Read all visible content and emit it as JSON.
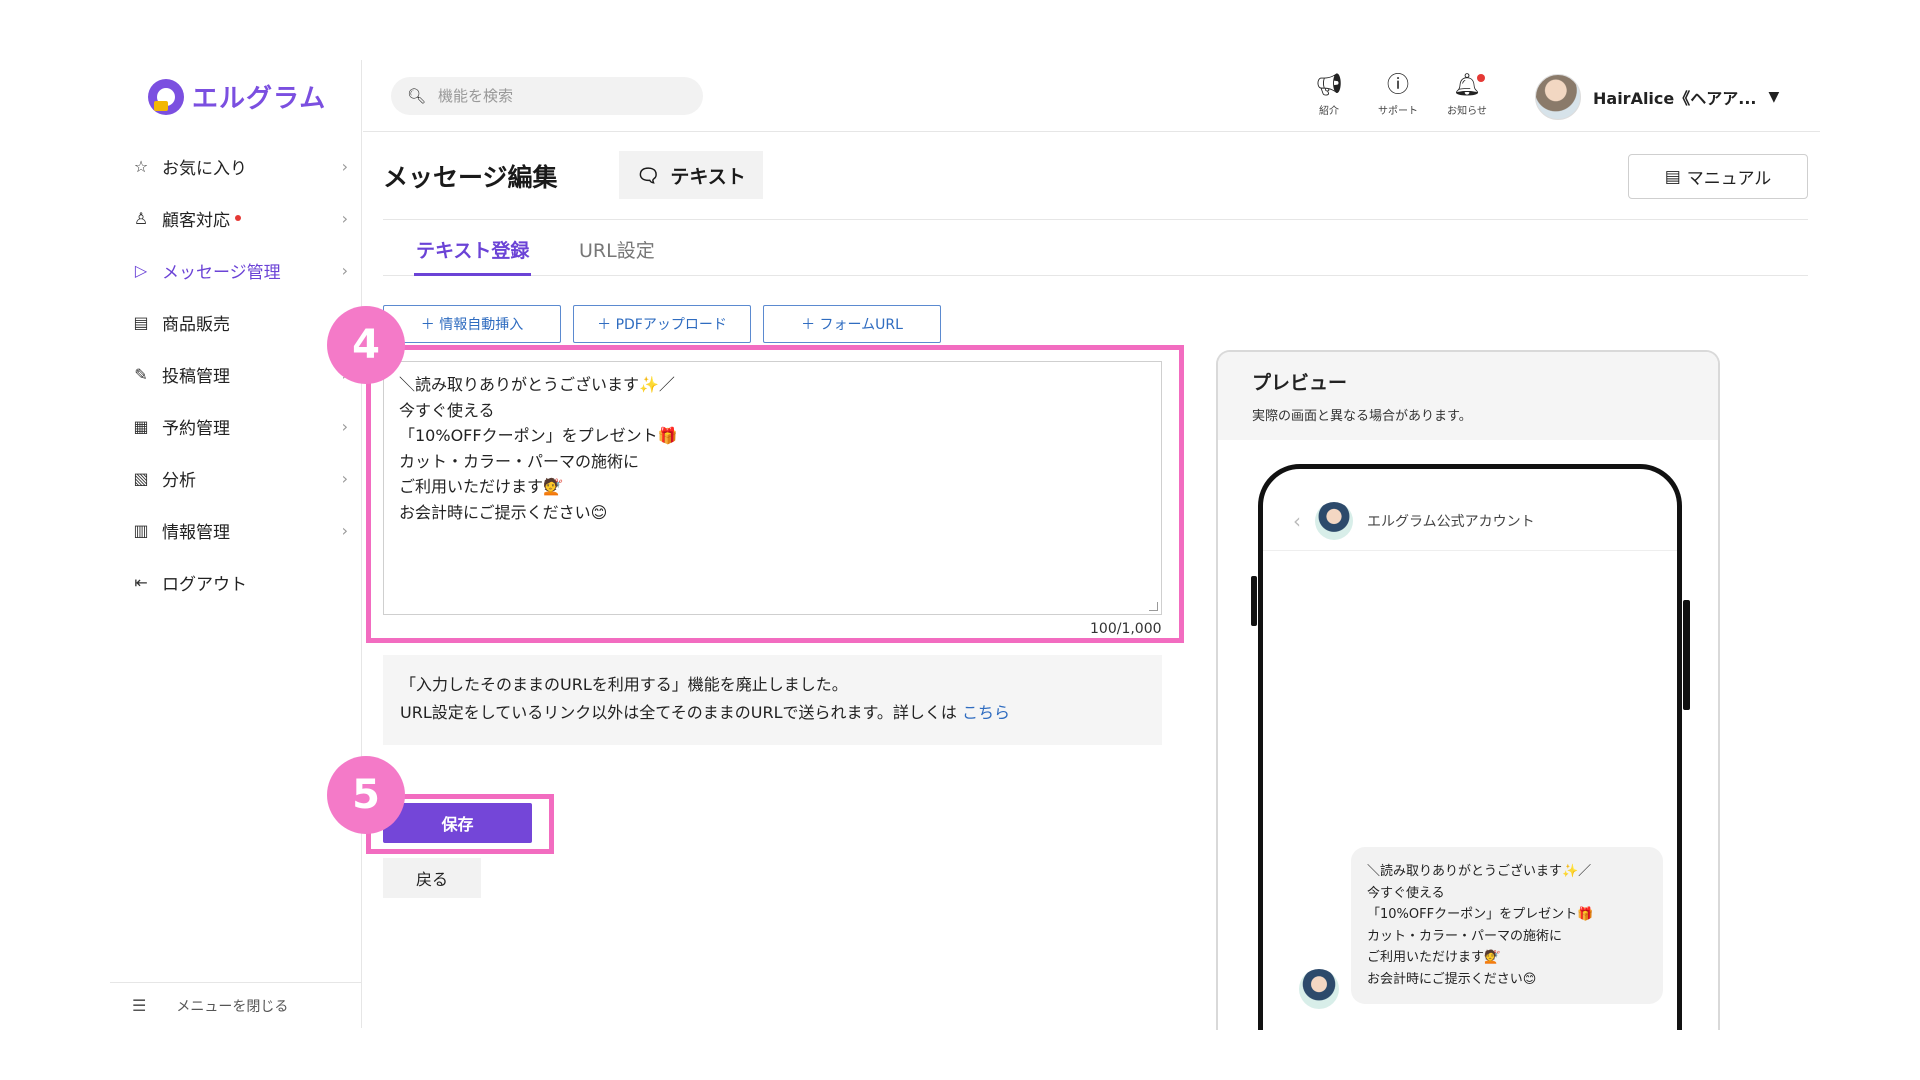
{
  "app": {
    "logo_text": "エルグラム"
  },
  "sidebar": {
    "items": [
      {
        "label": "お気に入り",
        "icon": "star-icon"
      },
      {
        "label": "顧客対応",
        "icon": "person-icon",
        "badge": "red-dot"
      },
      {
        "label": "メッセージ管理",
        "icon": "send-icon",
        "active": true
      },
      {
        "label": "商品販売",
        "icon": "store-icon"
      },
      {
        "label": "投稿管理",
        "icon": "edit-icon"
      },
      {
        "label": "予約管理",
        "icon": "calendar-icon"
      },
      {
        "label": "分析",
        "icon": "report-icon"
      },
      {
        "label": "情報管理",
        "icon": "chart-icon"
      },
      {
        "label": "ログアウト",
        "icon": "logout-icon"
      }
    ],
    "menu_close_label": "メニューを閉じる"
  },
  "header": {
    "search_placeholder": "機能を検索",
    "icons": [
      {
        "name": "megaphone-icon",
        "label": "紹介"
      },
      {
        "name": "help-icon",
        "label": "サポート"
      },
      {
        "name": "bell-icon",
        "label": "お知らせ"
      }
    ],
    "user_name": "HairAlice《ヘアア..."
  },
  "page": {
    "title": "メッセージ編集",
    "type_chip": "テキスト",
    "manual_label": "マニュアル",
    "tabs": [
      {
        "label": "テキスト登録",
        "active": true
      },
      {
        "label": "URL設定",
        "active": false
      }
    ],
    "insert_buttons": [
      "＋ 情報自動挿入",
      "＋ PDFアップロード",
      "＋ フォームURL"
    ],
    "message_text": "＼読み取りありがとうございます✨／\n今すぐ使える\n「10%OFFクーポン」をプレゼント🎁\nカット・カラー・パーマの施術に\nご利用いただけます💇\nお会計時にご提示ください😊",
    "char_count": "100/1,000",
    "notice_line1": "「入力したそのままのURLを利用する」機能を廃止しました。",
    "notice_line2": "URL設定をしているリンク以外は全てそのままのURLで送られます。詳しくは",
    "notice_link": "こちら",
    "save_label": "保存",
    "back_label": "戻る"
  },
  "annotations": {
    "step4": "4",
    "step5": "5",
    "highlight_color": "#f26cc0"
  },
  "preview": {
    "title": "プレビュー",
    "subtitle": "実際の画面と異なる場合があります。",
    "account_name": "エルグラム公式アカウント",
    "bubble_text": "＼読み取りありがとうございます✨／\n今すぐ使える\n「10%OFFクーポン」をプレゼント🎁\nカット・カラー・パーマの施術に\nご利用いただけます💇\nお会計時にご提示ください😊"
  },
  "colors": {
    "accent": "#6b43d6",
    "save_button": "#7446d8",
    "link": "#2f6cc0",
    "alert_dot": "#e53935"
  }
}
